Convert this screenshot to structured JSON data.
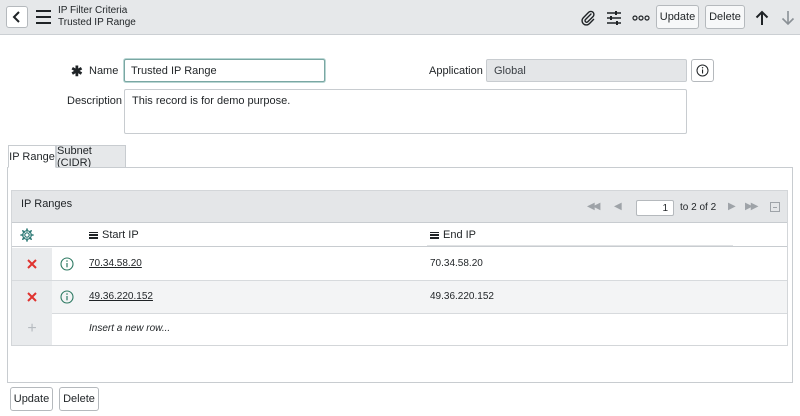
{
  "header": {
    "title_line1": "IP Filter Criteria",
    "title_line2": "Trusted IP Range",
    "update_label": "Update",
    "delete_label": "Delete"
  },
  "form": {
    "name_label": "Name",
    "name_value": "Trusted IP Range",
    "application_label": "Application",
    "application_value": "Global",
    "description_label": "Description",
    "description_value": "This record is for demo purpose."
  },
  "tabs": [
    {
      "label": "IP Range",
      "active": true
    },
    {
      "label": "Subnet (CIDR)",
      "active": false
    }
  ],
  "related_list": {
    "title": "IP Ranges",
    "page_input": "1",
    "page_of": "to 2 of 2",
    "columns": {
      "start": "Start IP",
      "end": "End IP"
    },
    "rows": [
      {
        "start": "70.34.58.20",
        "end": "70.34.58.20"
      },
      {
        "start": "49.36.220.152",
        "end": "49.36.220.152"
      }
    ],
    "insert_label": "Insert a new row..."
  },
  "footer": {
    "update_label": "Update",
    "delete_label": "Delete"
  },
  "colors": {
    "header_bg": "#e6e8ea",
    "delete_x": "#e0332f",
    "info_green": "#2e7a63",
    "gear": "#2e7a76"
  }
}
